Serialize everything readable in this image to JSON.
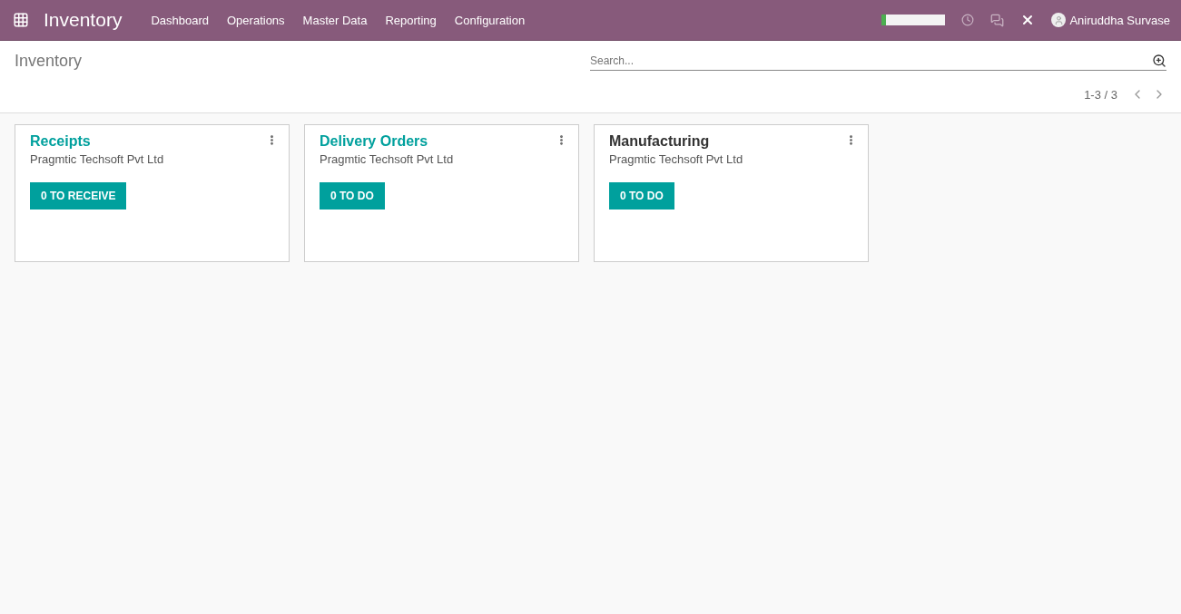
{
  "navbar": {
    "app_title": "Inventory",
    "menu": [
      "Dashboard",
      "Operations",
      "Master Data",
      "Reporting",
      "Configuration"
    ],
    "progress": {
      "level": 0.07
    },
    "user": "Aniruddha Survase"
  },
  "control_panel": {
    "breadcrumb": "Inventory",
    "search": {
      "placeholder": "Search..."
    },
    "pager": "1-3 / 3"
  },
  "cards": [
    {
      "title": "Receipts",
      "linked": true,
      "company": "Pragmtic Techsoft Pvt Ltd",
      "action": "0 TO RECEIVE"
    },
    {
      "title": "Delivery Orders",
      "linked": true,
      "company": "Pragmtic Techsoft Pvt Ltd",
      "action": "0 TO DO"
    },
    {
      "title": "Manufacturing",
      "linked": false,
      "company": "Pragmtic Techsoft Pvt Ltd",
      "action": "0 TO DO"
    }
  ]
}
